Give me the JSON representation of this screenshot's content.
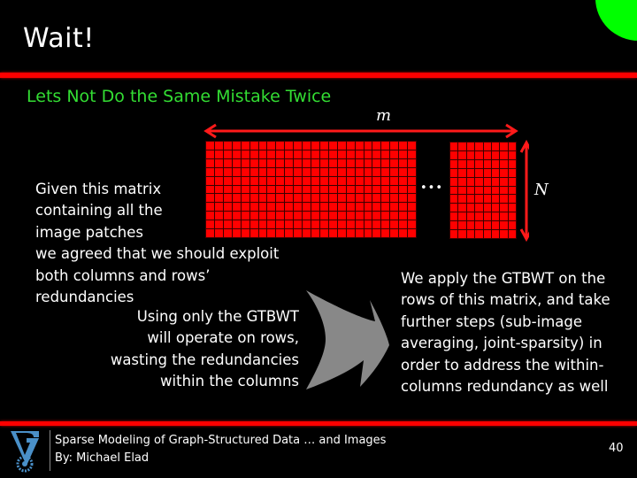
{
  "slide": {
    "title": "Wait!",
    "subtitle": "Lets Not Do the Same Mistake Twice",
    "colors": {
      "background": "#000000",
      "accent_line": "#ff0000",
      "subtitle": "#33dd33",
      "corner_circle": "#00ff00",
      "matrix_cell": "#ff0000",
      "arrow_shape": "#888888",
      "logo": "#4a90c8"
    }
  },
  "diagram": {
    "width_label": "m",
    "height_label": "N",
    "ellipsis": "•••",
    "main_block": {
      "columns": 24,
      "rows": 11
    },
    "right_block": {
      "columns": 8,
      "rows": 11
    }
  },
  "left_text": {
    "lines": [
      "Given this  matrix",
      "containing all the",
      "image patches",
      "we agreed that we should exploit",
      "both columns and rows’",
      "redundancies"
    ]
  },
  "note_text": {
    "lines": [
      "Using only the GTBWT",
      "will operate on rows,",
      "wasting the redundancies",
      "within the columns"
    ]
  },
  "right_text": {
    "lines": [
      "We apply the GTBWT on the",
      "rows of this matrix, and take",
      "further steps (sub-image",
      "averaging, joint-sparsity) in",
      "order to address the within-",
      "columns redundancy as well"
    ]
  },
  "footer": {
    "title": "Sparse Modeling of Graph-Structured Data … and Images",
    "author": "By: Michael Elad",
    "page_number": "40",
    "logo": "technion-logo-icon"
  }
}
